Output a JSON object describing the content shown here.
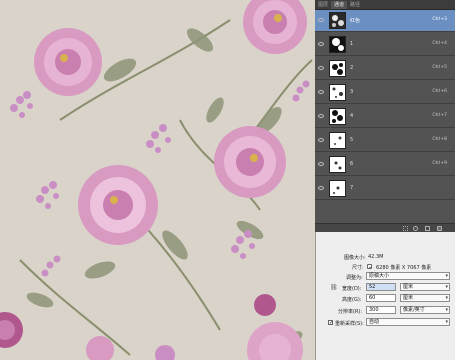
{
  "colors": {
    "wallpaper": "#d9d3c9",
    "panel_bg": "#535353",
    "layer_selected": "#6a8fc0",
    "dialog_bg": "#eeeeee"
  },
  "panel": {
    "tabs": [
      "图层",
      "通道",
      "路径"
    ],
    "active_tab": "通道",
    "layers": [
      {
        "name": "红色",
        "shortcut": "Ctrl+3",
        "selected": true
      },
      {
        "name": "1",
        "shortcut": "Ctrl+4"
      },
      {
        "name": "2",
        "shortcut": "Ctrl+5"
      },
      {
        "name": "3",
        "shortcut": "Ctrl+6"
      },
      {
        "name": "4",
        "shortcut": "Ctrl+7"
      },
      {
        "name": "5",
        "shortcut": "Ctrl+8"
      },
      {
        "name": "6",
        "shortcut": "Ctrl+9"
      },
      {
        "name": "7",
        "shortcut": ""
      }
    ]
  },
  "dialog": {
    "image_size_label": "图像大小:",
    "image_size_value": "42.3M",
    "dimensions_label": "尺寸:",
    "dimensions_value": "6280 像素 X 7067 像素",
    "fit_label": "调整为:",
    "fit_value": "原稿大小",
    "width_label": "宽度(D):",
    "width_value": "52",
    "width_unit": "厘米",
    "height_label": "高度(G):",
    "height_value": "60",
    "height_unit": "厘米",
    "resolution_label": "分辨率(R):",
    "resolution_value": "300",
    "resolution_unit": "像素/英寸",
    "resample_label": "重新采样(S):",
    "resample_value": "自动"
  }
}
